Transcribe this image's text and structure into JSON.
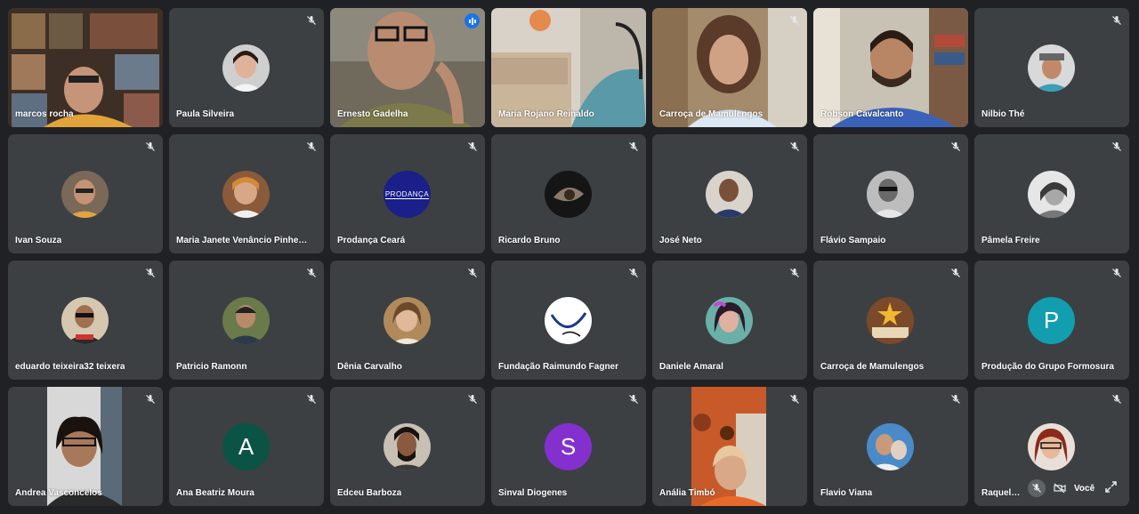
{
  "participants": [
    {
      "name": "marcos rocha"
    },
    {
      "name": "Paula Silveira"
    },
    {
      "name": "Ernesto Gadelha"
    },
    {
      "name": "Maria Rojano Reinaldo"
    },
    {
      "name": "Carroça de Mamulengos"
    },
    {
      "name": "Robson Cavalcanto"
    },
    {
      "name": "Nilbio Thé"
    },
    {
      "name": "Ivan Souza"
    },
    {
      "name": "Maria Janete Venâncio Pinheiro V..."
    },
    {
      "name": "Prodança Ceará",
      "avatar_text": "PRODANÇA"
    },
    {
      "name": "Ricardo Bruno"
    },
    {
      "name": "José Neto"
    },
    {
      "name": "Flávio Sampaio"
    },
    {
      "name": "Pâmela Freire"
    },
    {
      "name": "eduardo teixeira32 teixera"
    },
    {
      "name": "Patricio Ramonn"
    },
    {
      "name": "Dênia Carvalho"
    },
    {
      "name": "Fundação Raimundo Fagner"
    },
    {
      "name": "Daniele Amaral"
    },
    {
      "name": "Carroça de Mamulengos"
    },
    {
      "name": "Produção do Grupo Formosura",
      "initial": "P"
    },
    {
      "name": "Andrea Vasconcelos"
    },
    {
      "name": "Ana Beatriz Moura",
      "initial": "A"
    },
    {
      "name": "Edceu Barboza"
    },
    {
      "name": "Sinval Diogenes",
      "initial": "S"
    },
    {
      "name": "Anália Timbó"
    },
    {
      "name": "Flavio Viana"
    },
    {
      "name": "Raquel Hon"
    }
  ],
  "self_tile": {
    "label": "Você"
  },
  "colors": {
    "background": "#202124",
    "tile": "#3c4043",
    "speaking_border": "#8ab4f8",
    "avatar_teal": "#129eaf",
    "avatar_green": "#0b5345",
    "avatar_purple": "#8430ce"
  },
  "icons": [
    "mic-off-icon",
    "speaking-indicator-icon",
    "camera-off-icon",
    "expand-icon"
  ]
}
